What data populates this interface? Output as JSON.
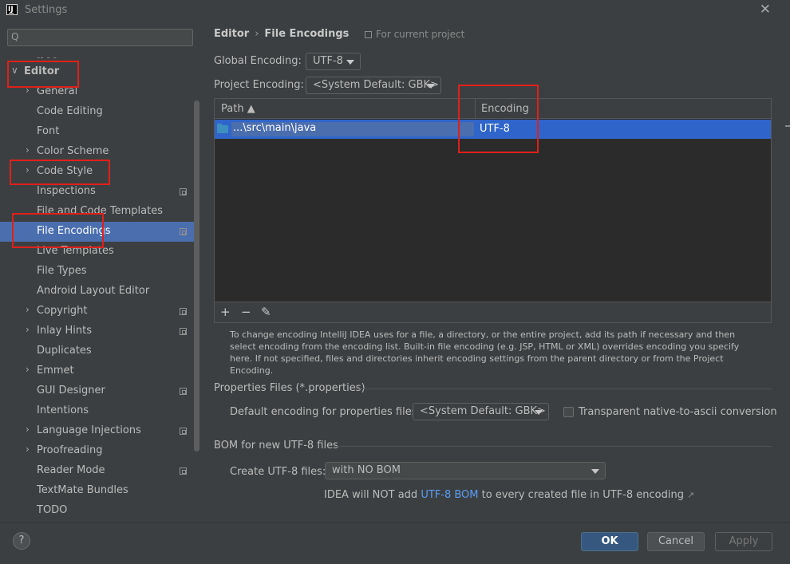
{
  "window": {
    "title": "Settings",
    "app_icon_text": "IJ"
  },
  "search": {
    "glyph": "Q",
    "placeholder": ""
  },
  "sidebar": {
    "top_fragment": "-- - -",
    "items": [
      {
        "label": "Editor",
        "arrow": "∨",
        "level": 0,
        "bold": true,
        "selected": false,
        "icon": false
      },
      {
        "label": "General",
        "arrow": "›",
        "level": 1,
        "selected": false,
        "icon": false
      },
      {
        "label": "Code Editing",
        "arrow": "",
        "level": 1,
        "selected": false,
        "icon": false
      },
      {
        "label": "Font",
        "arrow": "",
        "level": 1,
        "selected": false,
        "icon": false
      },
      {
        "label": "Color Scheme",
        "arrow": "›",
        "level": 1,
        "selected": false,
        "icon": false
      },
      {
        "label": "Code Style",
        "arrow": "›",
        "level": 1,
        "selected": false,
        "icon": false
      },
      {
        "label": "Inspections",
        "arrow": "",
        "level": 1,
        "selected": false,
        "icon": true
      },
      {
        "label": "File and Code Templates",
        "arrow": "",
        "level": 1,
        "selected": false,
        "icon": false
      },
      {
        "label": "File Encodings",
        "arrow": "",
        "level": 1,
        "selected": true,
        "icon": true
      },
      {
        "label": "Live Templates",
        "arrow": "",
        "level": 1,
        "selected": false,
        "icon": false
      },
      {
        "label": "File Types",
        "arrow": "",
        "level": 1,
        "selected": false,
        "icon": false
      },
      {
        "label": "Android Layout Editor",
        "arrow": "",
        "level": 1,
        "selected": false,
        "icon": false
      },
      {
        "label": "Copyright",
        "arrow": "›",
        "level": 1,
        "selected": false,
        "icon": true
      },
      {
        "label": "Inlay Hints",
        "arrow": "›",
        "level": 1,
        "selected": false,
        "icon": true
      },
      {
        "label": "Duplicates",
        "arrow": "",
        "level": 1,
        "selected": false,
        "icon": false
      },
      {
        "label": "Emmet",
        "arrow": "›",
        "level": 1,
        "selected": false,
        "icon": false
      },
      {
        "label": "GUI Designer",
        "arrow": "",
        "level": 1,
        "selected": false,
        "icon": true
      },
      {
        "label": "Intentions",
        "arrow": "",
        "level": 1,
        "selected": false,
        "icon": false
      },
      {
        "label": "Language Injections",
        "arrow": "›",
        "level": 1,
        "selected": false,
        "icon": true
      },
      {
        "label": "Proofreading",
        "arrow": "›",
        "level": 1,
        "selected": false,
        "icon": false
      },
      {
        "label": "Reader Mode",
        "arrow": "",
        "level": 1,
        "selected": false,
        "icon": true
      },
      {
        "label": "TextMate Bundles",
        "arrow": "",
        "level": 1,
        "selected": false,
        "icon": false
      },
      {
        "label": "TODO",
        "arrow": "",
        "level": 1,
        "selected": false,
        "icon": false
      }
    ]
  },
  "main": {
    "breadcrumb": {
      "root": "Editor",
      "sep": "›",
      "current": "File Encodings"
    },
    "for_project": "For current project",
    "global_encoding": {
      "label": "Global Encoding:",
      "value": "UTF-8"
    },
    "project_encoding": {
      "label": "Project Encoding:",
      "value": "<System Default: GBK>"
    },
    "table": {
      "col_path": "Path ▲",
      "col_encoding": "Encoding",
      "rows": [
        {
          "path": "...\\src\\main\\java",
          "encoding": "UTF-8"
        }
      ],
      "toolbar": {
        "add": "+",
        "remove": "−",
        "edit": "✎"
      }
    },
    "help_text": "To change encoding IntelliJ IDEA uses for a file, a directory, or the entire project, add its path if necessary and then select encoding from the encoding list. Built-in file encoding (e.g. JSP, HTML or XML) overrides encoding you specify here. If not specified, files and directories inherit encoding settings from the parent directory or from the Project Encoding.",
    "properties": {
      "section": "Properties Files (*.properties)",
      "default_label": "Default encoding for properties files:",
      "default_value": "<System Default: GBK>",
      "transparent_label": "Transparent native-to-ascii conversion",
      "transparent_checked": false
    },
    "bom": {
      "section": "BOM for new UTF-8 files",
      "create_label": "Create UTF-8 files:",
      "create_value": "with NO BOM",
      "note_pre": "IDEA will NOT add ",
      "note_link": "UTF-8 BOM",
      "note_post": " to every created file in UTF-8 encoding",
      "note_ext": "↗"
    }
  },
  "footer": {
    "help": "?",
    "ok": "OK",
    "cancel": "Cancel",
    "apply": "Apply"
  },
  "colors": {
    "selection": "#4b6eaf",
    "table_selection": "#2f65ca",
    "link": "#589df6",
    "annotation": "#e0201a",
    "ok_button": "#365880"
  }
}
